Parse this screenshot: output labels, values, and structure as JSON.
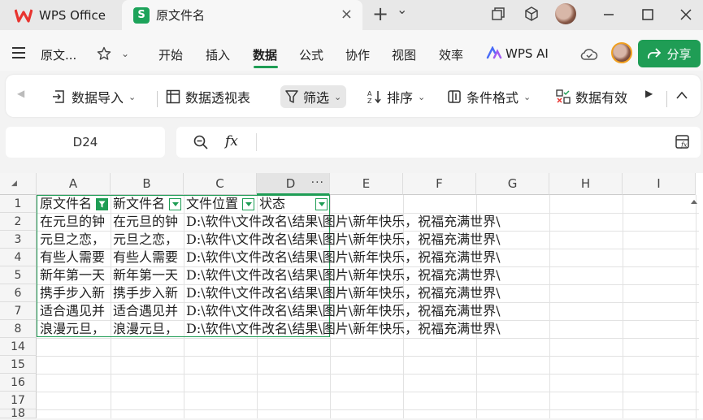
{
  "titlebar": {
    "home_tab": "WPS Office",
    "doc_tab": "原文件名",
    "doc_logo": "S",
    "close": "×",
    "new_tab": "+",
    "dropdown": "⌄"
  },
  "menubar": {
    "doc_name": "原文...",
    "items": [
      "开始",
      "插入",
      "数据",
      "公式",
      "协作",
      "视图",
      "效率",
      "WPS AI"
    ],
    "active": "数据",
    "share": "分享"
  },
  "toolbar": {
    "items": [
      "数据导入",
      "数据透视表",
      "筛选",
      "排序",
      "条件格式",
      "数据有效"
    ]
  },
  "namebox": "D24",
  "formula_fx": "fx",
  "columns": [
    "A",
    "B",
    "C",
    "D",
    "E",
    "F",
    "G",
    "H",
    "I"
  ],
  "rows": [
    "1",
    "2",
    "3",
    "4",
    "5",
    "6",
    "7",
    "8",
    "14",
    "15",
    "16",
    "17",
    "18"
  ],
  "headers": {
    "a": "原文件名",
    "b": "新文件名",
    "c": "文件位置",
    "d": "状态"
  },
  "cells_a": [
    "在元旦的钟",
    "元旦之恋，",
    "有些人需要",
    "新年第一天",
    "携手步入新",
    "适合遇见并",
    "浪漫元旦，"
  ],
  "cells_b": [
    "在元旦的钟",
    "元旦之恋，",
    "有些人需要",
    "新年第一天",
    "携手步入新",
    "适合遇见并",
    "浪漫元旦，"
  ],
  "cells_c": [
    "D:\\软件\\文件改名\\结果\\图片\\新年快乐，祝福充满世界\\",
    "D:\\软件\\文件改名\\结果\\图片\\新年快乐，祝福充满世界\\",
    "D:\\软件\\文件改名\\结果\\图片\\新年快乐，祝福充满世界\\",
    "D:\\软件\\文件改名\\结果\\图片\\新年快乐，祝福充满世界\\",
    "D:\\软件\\文件改名\\结果\\图片\\新年快乐，祝福充满世界\\",
    "D:\\软件\\文件改名\\结果\\图片\\新年快乐，祝福充满世界\\",
    "D:\\软件\\文件改名\\结果\\图片\\新年快乐，祝福充满世界\\"
  ],
  "colors": {
    "accent": "#1f9d55",
    "wps_red": "#e8342f"
  }
}
